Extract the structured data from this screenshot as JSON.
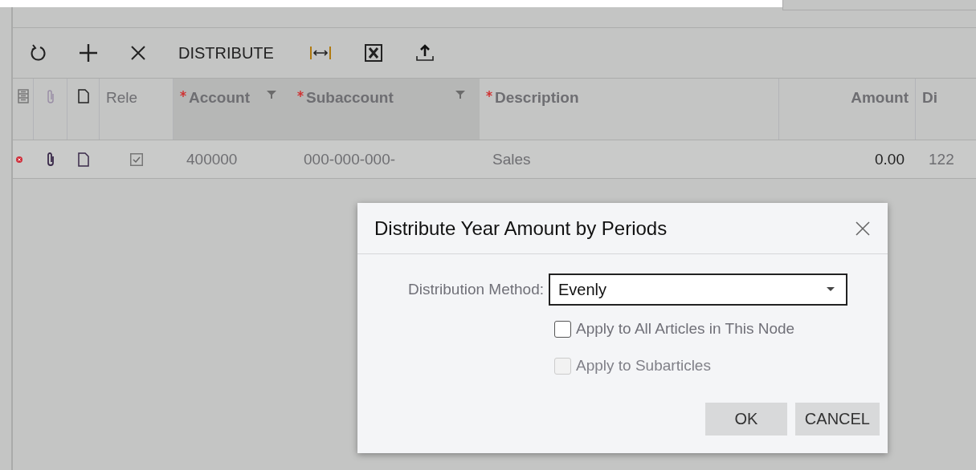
{
  "toolbar": [
    {
      "kind": "refresh"
    },
    {
      "kind": "add"
    },
    {
      "kind": "delete"
    },
    {
      "kind": "text",
      "label": "DISTRIBUTE"
    },
    {
      "kind": "fit"
    },
    {
      "kind": "excel"
    },
    {
      "kind": "upload"
    }
  ],
  "table": {
    "tool_columns": [
      {
        "kind": "settings"
      },
      {
        "kind": "attach"
      },
      {
        "kind": "note"
      }
    ],
    "columns": [
      {
        "label": "Rele",
        "required": false,
        "filter": false,
        "highlighted": false
      },
      {
        "label": "Account",
        "required": true,
        "filter": true,
        "highlighted": true
      },
      {
        "label": "Subaccount",
        "required": true,
        "filter": true,
        "highlighted": true
      },
      {
        "label": "Description",
        "required": true,
        "filter": false,
        "highlighted": false
      },
      {
        "label": "Amount",
        "required": false,
        "filter": false,
        "highlighted": false
      },
      {
        "label": "Di",
        "required": false,
        "filter": false,
        "highlighted": false
      }
    ],
    "rows": [
      {
        "error": true,
        "attached": true,
        "note": true,
        "released": true,
        "cells": [
          "",
          "400000",
          "000-000-000-",
          "Sales",
          "0.00",
          "122"
        ]
      }
    ]
  },
  "dialog": {
    "title": "Distribute Year Amount by Periods",
    "field": {
      "label": "Distribution Method:",
      "value": "Evenly"
    },
    "checkboxes": [
      {
        "label": "Apply to All Articles in This Node",
        "checked": false,
        "disabled": false
      },
      {
        "label": "Apply to Subarticles",
        "checked": false,
        "disabled": true
      }
    ],
    "buttons": [
      "OK",
      "CANCEL"
    ]
  }
}
